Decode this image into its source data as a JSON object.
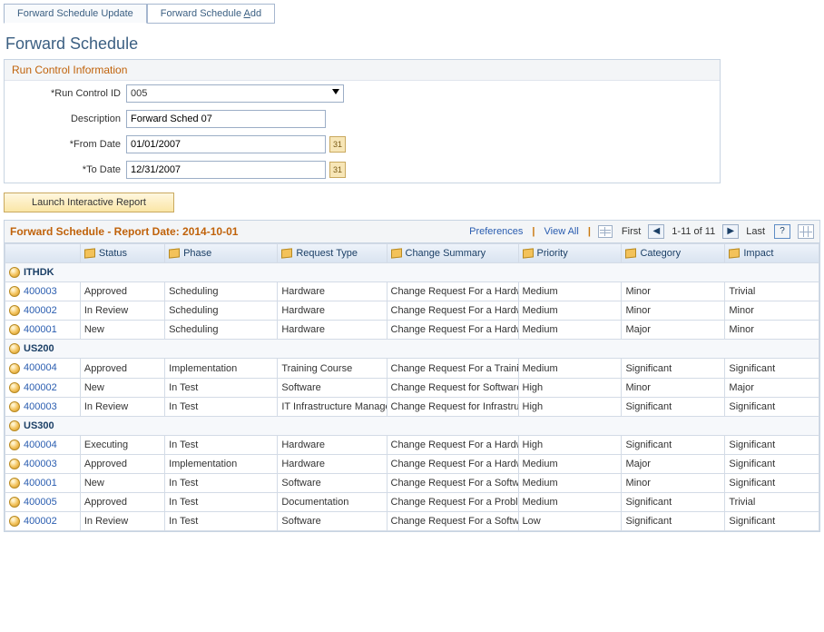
{
  "tabs": {
    "update": "Forward Schedule Update",
    "add_prefix": "Forward Schedule ",
    "add_accel": "A",
    "add_suffix": "dd"
  },
  "page_title": "Forward Schedule",
  "run_control": {
    "header": "Run Control Information",
    "id_label": "*Run Control ID",
    "id_value": "005",
    "desc_label": "Description",
    "desc_value": "Forward Sched 07",
    "from_label": "*From Date",
    "from_value": "01/01/2007",
    "to_label": "*To Date",
    "to_value": "12/31/2007"
  },
  "launch_label": "Launch Interactive Report",
  "grid_bar": {
    "title_prefix": "Forward Schedule - Report Date: ",
    "report_date": "2014-10-01",
    "preferences": "Preferences",
    "view_all": "View All",
    "first": "First",
    "range": "1-11 of 11",
    "last": "Last"
  },
  "columns": {
    "status": "Status",
    "phase": "Phase",
    "request_type": "Request Type",
    "summary": "Change Summary",
    "priority": "Priority",
    "category": "Category",
    "impact": "Impact"
  },
  "groups": [
    {
      "name": "ITHDK",
      "rows": [
        {
          "id": "400003",
          "status": "Approved",
          "phase": "Scheduling",
          "type": "Hardware",
          "summary": "Change Request For a Hardware Upgrade",
          "priority": "Medium",
          "category": "Minor",
          "impact": "Trivial"
        },
        {
          "id": "400002",
          "status": "In Review",
          "phase": "Scheduling",
          "type": "Hardware",
          "summary": "Change Request For a Hardware Fix",
          "priority": "Medium",
          "category": "Minor",
          "impact": "Minor"
        },
        {
          "id": "400001",
          "status": "New",
          "phase": "Scheduling",
          "type": "Hardware",
          "summary": "Change Request For a Hardware Upgrade",
          "priority": "Medium",
          "category": "Major",
          "impact": "Minor"
        }
      ]
    },
    {
      "name": "US200",
      "rows": [
        {
          "id": "400004",
          "status": "Approved",
          "phase": "Implementation",
          "type": "Training Course",
          "summary": "Change Request For a Training Course",
          "priority": "Medium",
          "category": "Significant",
          "impact": "Significant"
        },
        {
          "id": "400002",
          "status": "New",
          "phase": "In Test",
          "type": "Software",
          "summary": "Change Request for Software Requirement.",
          "priority": "High",
          "category": "Minor",
          "impact": "Major"
        },
        {
          "id": "400003",
          "status": "In Review",
          "phase": "In Test",
          "type": "IT Infrastructure Management",
          "summary": "Change Request for Infrastructure Management",
          "priority": "High",
          "category": "Significant",
          "impact": "Significant"
        }
      ]
    },
    {
      "name": "US300",
      "rows": [
        {
          "id": "400004",
          "status": "Executing",
          "phase": "In Test",
          "type": "Hardware",
          "summary": "Change Request For a Hardware Facility",
          "priority": "High",
          "category": "Significant",
          "impact": "Significant"
        },
        {
          "id": "400003",
          "status": "Approved",
          "phase": "Implementation",
          "type": "Hardware",
          "summary": "Change Request For a Hardware Requirement",
          "priority": "Medium",
          "category": "Major",
          "impact": "Significant"
        },
        {
          "id": "400001",
          "status": "New",
          "phase": "In Test",
          "type": "Software",
          "summary": "Change Request For a Software Requirement",
          "priority": "Medium",
          "category": "Minor",
          "impact": "Significant"
        },
        {
          "id": "400005",
          "status": "Approved",
          "phase": "In Test",
          "type": "Documentation",
          "summary": "Change Request For a Problem in Documentation",
          "priority": "Medium",
          "category": "Significant",
          "impact": "Trivial"
        },
        {
          "id": "400002",
          "status": "In Review",
          "phase": "In Test",
          "type": "Software",
          "summary": "Change Request For a Software Requirement",
          "priority": "Low",
          "category": "Significant",
          "impact": "Significant"
        }
      ]
    }
  ]
}
